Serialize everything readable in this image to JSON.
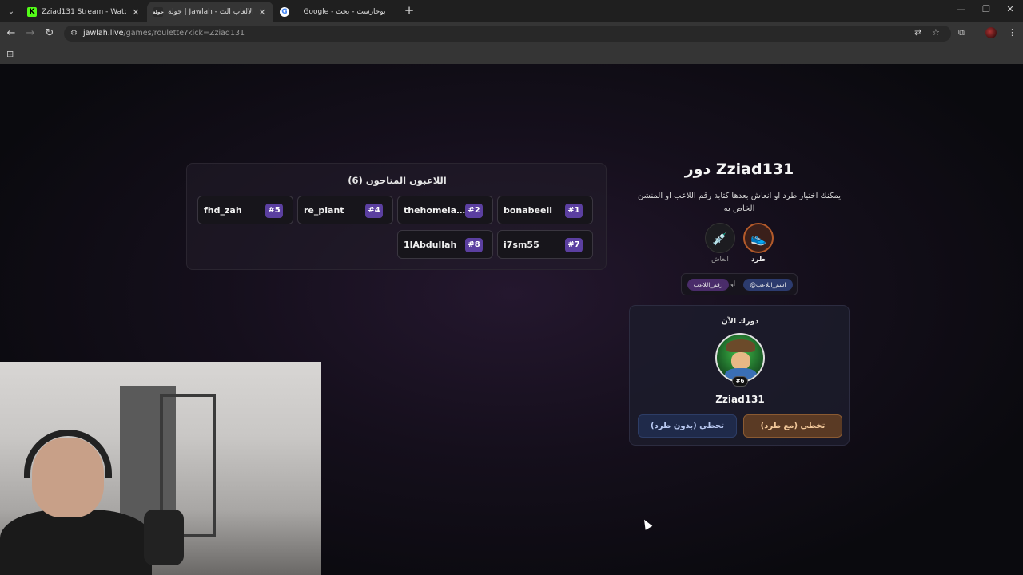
{
  "browser": {
    "tabs": [
      {
        "title": "Zziad131 Stream - Watch Live o",
        "active": false
      },
      {
        "title": "جولة | Jawlah - منصة الألعاب الت",
        "active": true
      },
      {
        "title": "Google - بوخارست - بحث",
        "active": false
      }
    ],
    "url_host": "jawlah.live",
    "url_path": "/games/roulette?kick=Zziad131"
  },
  "players": {
    "title": "اللاعبون المتاحون (6)",
    "items": [
      {
        "name": "bonabeell",
        "num": "#1"
      },
      {
        "name": "thehomelan...",
        "num": "#2"
      },
      {
        "name": "re_plant",
        "num": "#4"
      },
      {
        "name": "fhd_zah",
        "num": "#5"
      },
      {
        "name": "i7sm55",
        "num": "#7"
      },
      {
        "name": "1lAbdullah",
        "num": "#8"
      }
    ]
  },
  "turn": {
    "title": "دور Zziad131",
    "desc": "يمكنك اختيار طرد او انعاش بعدها كتابة رقم اللاعب او المنشن الخاص به",
    "kick_label": "طرد",
    "revive_label": "انعاش",
    "hint_name": "@اسم_اللاعب",
    "hint_or": "أو",
    "hint_num": "رقم_اللاعب"
  },
  "current": {
    "label": "دورك الآن",
    "name": "Zziad131",
    "badge": "#6",
    "skip_with_kick": "تخطي (مع طرد)",
    "skip_without_kick": "تخطي (بدون طرد)"
  },
  "colors": {
    "accent_purple": "#5b3fa0",
    "kick_orange": "#b35a2a"
  }
}
